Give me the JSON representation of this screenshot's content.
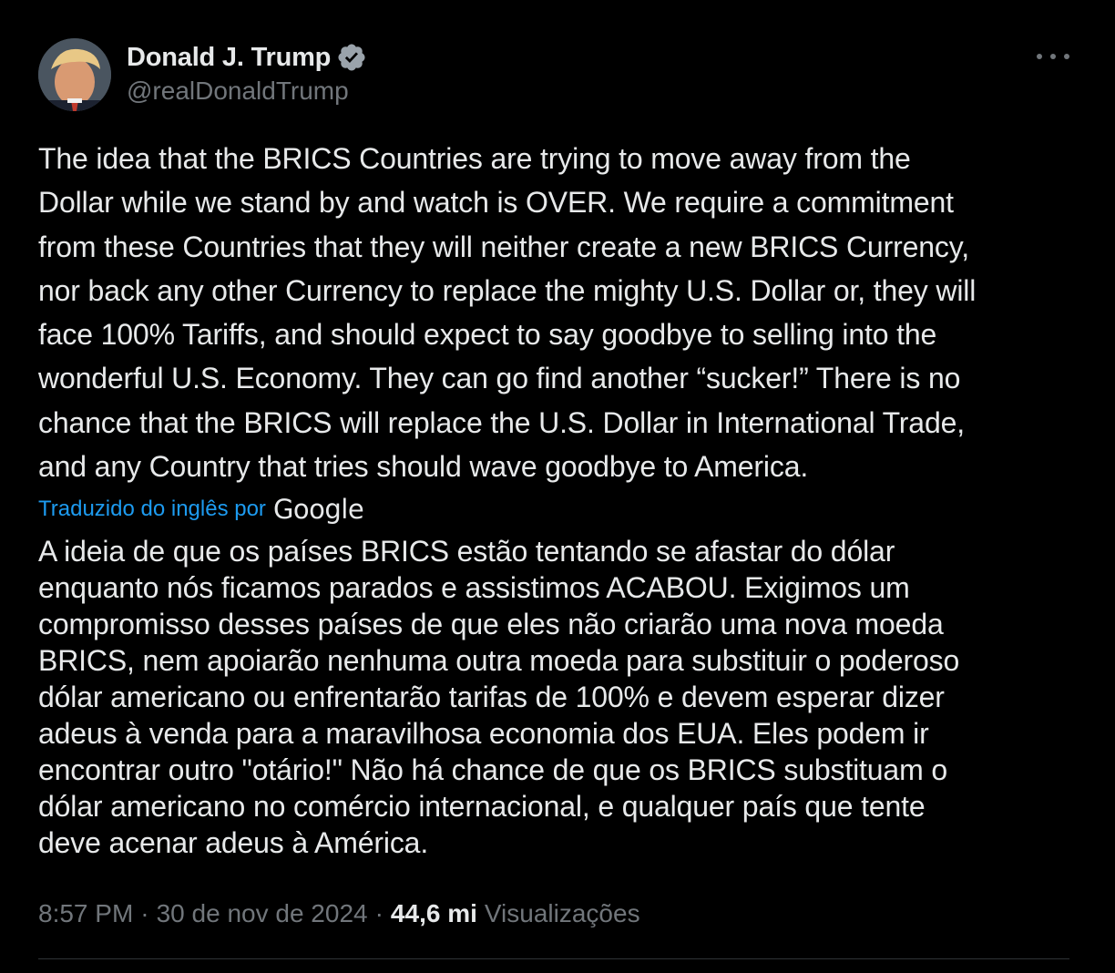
{
  "author": {
    "display_name": "Donald J. Trump",
    "handle": "@realDonaldTrump",
    "verified_badge_color": "#1d9bf0"
  },
  "more_icon": "more-horizontal-icon",
  "tweet": {
    "text_lines": [
      "The idea that the BRICS Countries are trying to move away from the",
      "Dollar while we stand by and watch is OVER. We require a commitment",
      "from these Countries that they will neither create a new BRICS Currency,",
      "nor back any other Currency to replace the mighty U.S. Dollar or, they will",
      "face 100% Tariffs, and should expect to say goodbye to selling into the",
      "wonderful U.S. Economy. They can go find another “sucker!” There is no",
      "chance that the BRICS will replace the U.S. Dollar in International Trade,",
      "and any Country that tries should wave goodbye to America."
    ]
  },
  "translation": {
    "label": "Traduzido do inglês por",
    "provider": "Google",
    "text_lines": [
      "A ideia de que os países BRICS estão tentando se afastar do dólar",
      "enquanto nós ficamos parados e assistimos ACABOU. Exigimos um",
      "compromisso desses países de que eles não criarão uma nova moeda",
      "BRICS, nem apoiarão nenhuma outra moeda para substituir o poderoso",
      "dólar americano ou enfrentarão tarifas de 100% e devem esperar dizer",
      "adeus à venda para a maravilhosa economia dos EUA. Eles podem ir",
      "encontrar outro \"otário!\" Não há chance de que os BRICS substituam o",
      "dólar americano no comércio internacional, e qualquer país que tente",
      "deve acenar adeus à América."
    ]
  },
  "meta": {
    "time": "8:57 PM",
    "separator": "·",
    "date": "30 de nov de 2024",
    "views_count": "44,6 mi",
    "views_label": "Visualizações"
  },
  "colors": {
    "background": "#000000",
    "text_primary": "#e7e9ea",
    "text_secondary": "#71767b",
    "link": "#1d9bf0",
    "divider": "#2f3336"
  }
}
